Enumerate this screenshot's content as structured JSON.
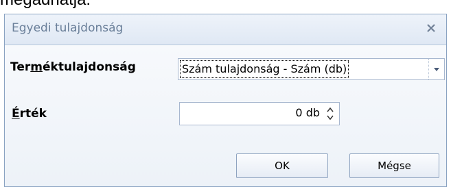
{
  "page": {
    "caption": "megadhatja."
  },
  "dialog": {
    "title": "Egyedi tulajdonság",
    "product_property": {
      "label_pre": "Ter",
      "label_mnemonic": "m",
      "label_post": "éktulajdonság",
      "selected_value": "Szám tulajdonság - Szám (db)"
    },
    "value": {
      "label_mnemonic": "É",
      "label_post": "rték",
      "current": "0 db"
    },
    "buttons": {
      "ok": "OK",
      "cancel": "Mégse"
    }
  },
  "icons": {
    "close": "close-icon",
    "combo_dropdown": "chevron-down-icon",
    "spin": "spin-updown-icon"
  }
}
